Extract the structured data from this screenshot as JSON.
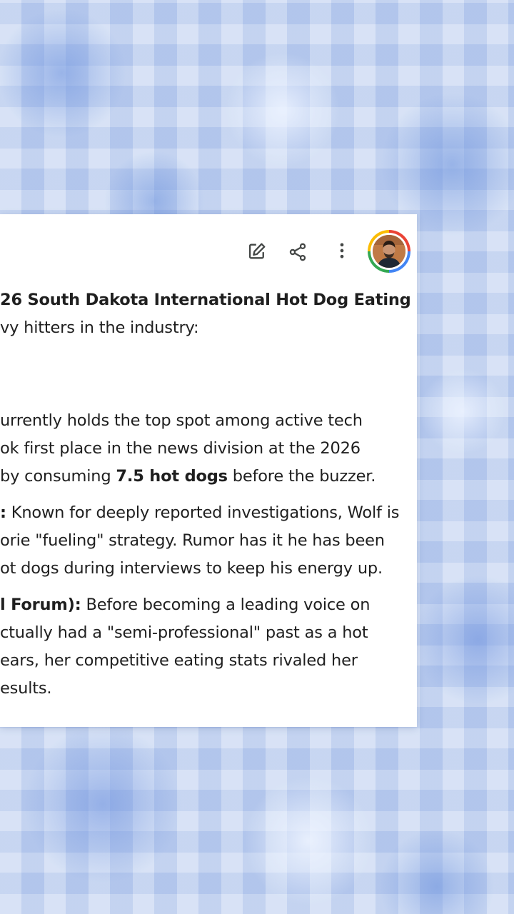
{
  "toolbar": {
    "edit_icon": "edit-icon",
    "share_icon": "share-icon",
    "more_icon": "more-vert-icon",
    "avatar": "user-avatar",
    "avatar_ring_colors": [
      "#ea4335",
      "#4285f4",
      "#34a853",
      "#fbbc05"
    ]
  },
  "response": {
    "intro": {
      "line1_bold": "26 South Dakota International Hot Dog Eating",
      "line2": "vy hitters in the industry:"
    },
    "item1": {
      "line1": "urrently holds the top spot among active tech",
      "line2": "ok first place in the news division at the 2026",
      "line3_pre": "by consuming ",
      "line3_bold": "7.5 hot dogs",
      "line3_post": " before the buzzer."
    },
    "item2": {
      "line1_bold": ":",
      "line1_text": " Known for deeply reported investigations, Wolf is",
      "line2": "orie \"fueling\" strategy. Rumor has it he has been",
      "line3": "ot dogs during interviews to keep his energy up."
    },
    "item3": {
      "line1_bold": "l Forum):",
      "line1_text": " Before becoming a leading voice on",
      "line2": "ctually had a \"semi-professional\" past as a hot",
      "line3": "ears, her competitive eating stats rivaled her",
      "line4": "esults."
    }
  }
}
